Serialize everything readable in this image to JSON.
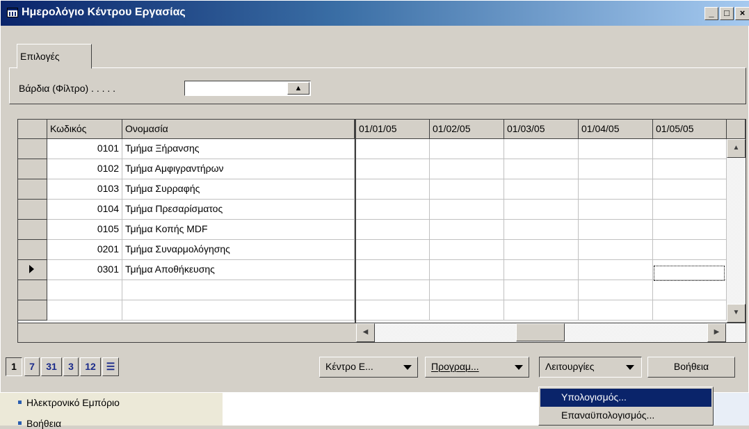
{
  "window": {
    "title": "Ημερολόγιο Κέντρου Εργασίας",
    "controls": {
      "minimize": "_",
      "maximize": "□",
      "close": "×"
    }
  },
  "tabs": [
    {
      "label": "Επιλογές"
    }
  ],
  "filter": {
    "label": "Βάρδια (Φίλτρο) . . . . .",
    "value": "",
    "button_icon": "up-arrow-icon"
  },
  "grid": {
    "columns": {
      "code": "Κωδικός",
      "name": "Ονομασία"
    },
    "dates": [
      "01/01/05",
      "01/02/05",
      "01/03/05",
      "01/04/05",
      "01/05/05"
    ],
    "rows": [
      {
        "code": "0101",
        "name": "Τμήμα Ξήρανσης"
      },
      {
        "code": "0102",
        "name": "Τμήμα Αμφιγραντήρων"
      },
      {
        "code": "0103",
        "name": "Τμήμα Συρραφής"
      },
      {
        "code": "0104",
        "name": "Τμήμα Πρεσαρίσματος"
      },
      {
        "code": "0105",
        "name": "Τμήμα Κοπής MDF"
      },
      {
        "code": "0201",
        "name": "Τμήμα Συναρμολόγησης"
      },
      {
        "code": "0301",
        "name": "Τμήμα Αποθήκευσης"
      },
      {
        "code": "",
        "name": ""
      },
      {
        "code": "",
        "name": ""
      }
    ],
    "current_row": 6
  },
  "period_buttons": [
    "1",
    "7",
    "31",
    "3",
    "12",
    "☰"
  ],
  "actions": {
    "work_center": "Κέντρο Ε...",
    "schedule": "Προγραμ...",
    "functions": "Λειτουργίες",
    "help": "Βοήθεια"
  },
  "menu": {
    "items": [
      "Υπολογισμός...",
      "Επαναϋπολογισμός..."
    ],
    "selected": 0
  },
  "background": {
    "item1": "Ηλεκτρονικό Εμπόριο",
    "item2": "Βοήθεια"
  },
  "colors": {
    "titlebar_start": "#0a246a",
    "titlebar_end": "#a6caf0",
    "menu_highlight": "#0a246a",
    "face": "#d4d0c8"
  }
}
